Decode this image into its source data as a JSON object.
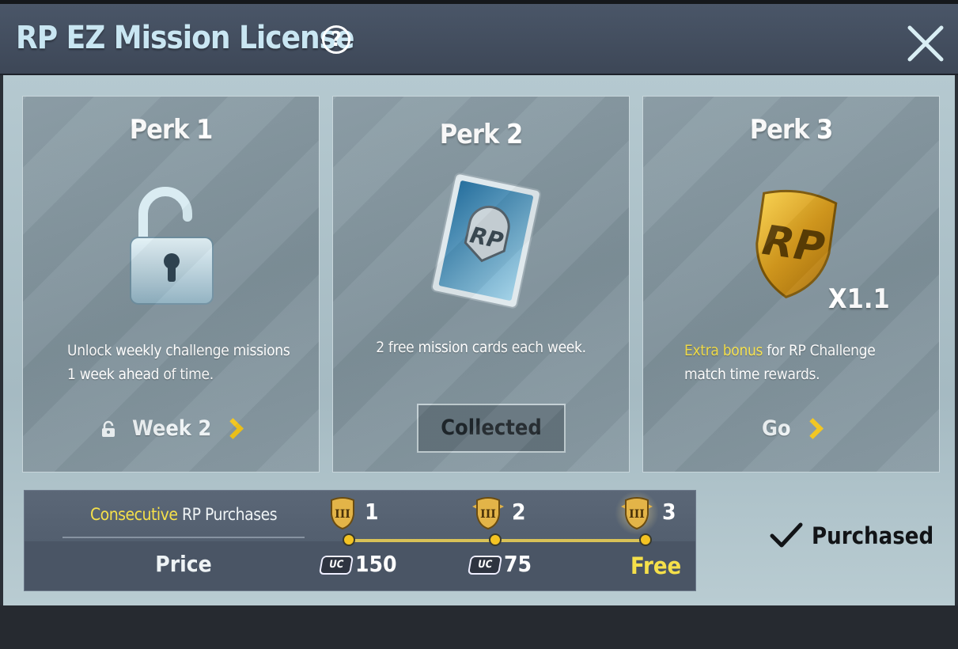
{
  "header": {
    "title": "RP EZ Mission License",
    "help_glyph": "?"
  },
  "perks": [
    {
      "title": "Perk 1",
      "icon": "unlocked-padlock-icon",
      "description": "Unlock weekly challenge missions 1 week ahead of time.",
      "action_label": "Week 2"
    },
    {
      "title": "Perk 2",
      "icon": "rp-mission-card-icon",
      "description": "2 free mission cards each week.",
      "button_label": "Collected"
    },
    {
      "title": "Perk 3",
      "icon": "rp-gold-shield-icon",
      "shield_text": "RP",
      "multiplier": "X1.1",
      "description_highlight": "Extra bonus",
      "description_rest": " for RP Challenge match time rewards.",
      "action_label": "Go"
    }
  ],
  "purchases": {
    "label_highlight": "Consecutive",
    "label_rest": " RP Purchases",
    "price_label": "Price",
    "tiers": [
      {
        "number": "1",
        "price": "150",
        "currency": "UC"
      },
      {
        "number": "2",
        "price": "75",
        "currency": "UC"
      },
      {
        "number": "3",
        "price": "Free"
      }
    ],
    "badge_text": "III",
    "status": "Purchased"
  },
  "colors": {
    "highlight": "#f5e04a",
    "chevron": "#f2c51a",
    "title": "#c9e6f2"
  }
}
